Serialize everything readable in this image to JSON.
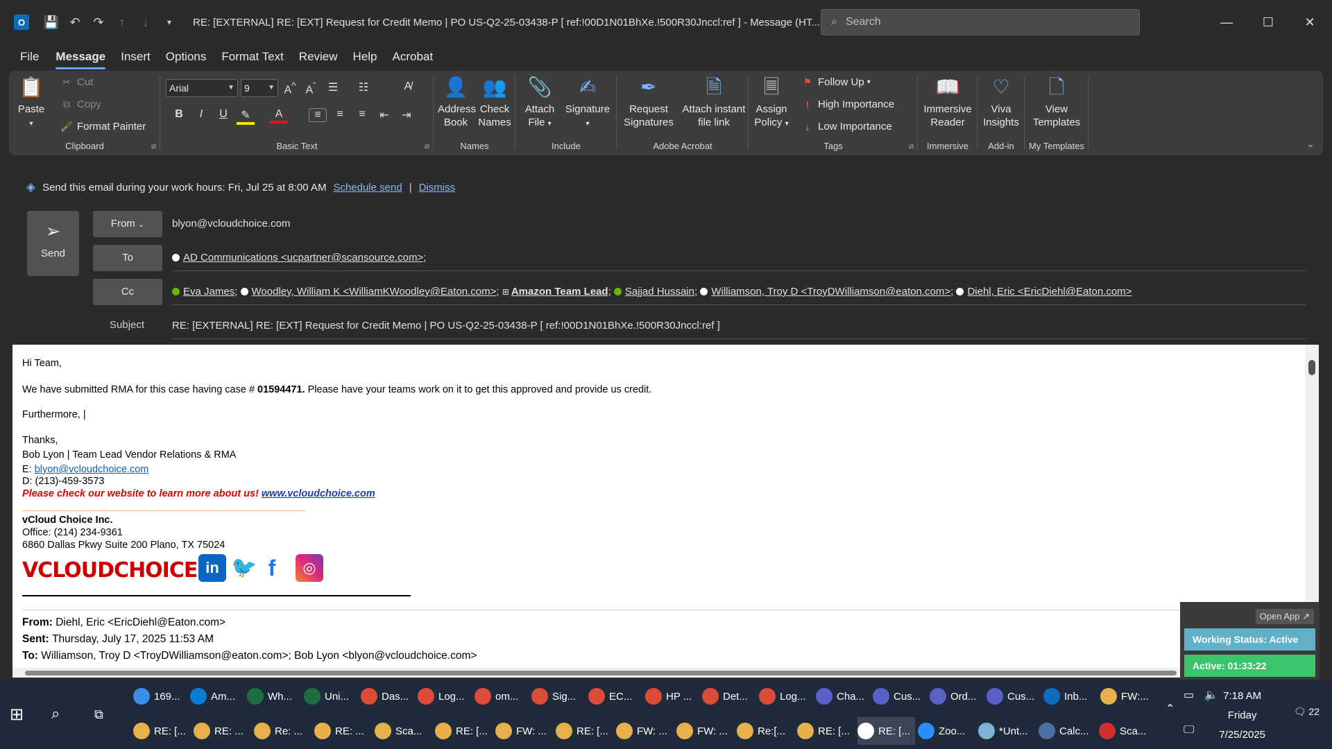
{
  "titlebar": {
    "title": "RE: [EXTERNAL] RE: [EXT] Request for Credit Memo | PO US-Q2-25-03438-P    [ ref:!00D1N01BhXe.!500R30Jnccl:ref ]  -  Message (HT...",
    "search_placeholder": "Search"
  },
  "menu": [
    "File",
    "Message",
    "Insert",
    "Options",
    "Format Text",
    "Review",
    "Help",
    "Acrobat"
  ],
  "ribbon": {
    "clipboard": {
      "label": "Clipboard",
      "paste": "Paste",
      "cut": "Cut",
      "copy": "Copy",
      "format_painter": "Format Painter"
    },
    "basic_text": {
      "label": "Basic Text",
      "font": "Arial",
      "size": "9"
    },
    "names": {
      "label": "Names",
      "address_book_1": "Address",
      "address_book_2": "Book",
      "check_names_1": "Check",
      "check_names_2": "Names"
    },
    "include": {
      "label": "Include",
      "attach_1": "Attach",
      "attach_2": "File",
      "signature": "Signature"
    },
    "adobe": {
      "label": "Adobe Acrobat",
      "req_1": "Request",
      "req_2": "Signatures",
      "attach_link_1": "Attach instant",
      "attach_link_2": "file link"
    },
    "tags": {
      "label": "Tags",
      "assign_1": "Assign",
      "assign_2": "Policy",
      "follow_up": "Follow Up",
      "high": "High Importance",
      "low": "Low Importance"
    },
    "immersive": {
      "label": "Immersive",
      "btn_1": "Immersive",
      "btn_2": "Reader"
    },
    "addin": {
      "label": "Add-in",
      "btn_1": "Viva",
      "btn_2": "Insights"
    },
    "templates": {
      "label": "My Templates",
      "btn_1": "View",
      "btn_2": "Templates"
    }
  },
  "banner": {
    "text": "Send this email during your work hours: Fri, Jul 25 at 8:00 AM",
    "schedule": "Schedule send",
    "pipe": "|",
    "dismiss": "Dismiss"
  },
  "header": {
    "send": "Send",
    "from_label": "From",
    "from_value": "blyon@vcloudchoice.com",
    "to_label": "To",
    "to_recipient": "AD Communications <ucpartner@scansource.com>",
    "cc_label": "Cc",
    "cc": {
      "eva": "Eva James",
      "woodley": "Woodley, William K <WilliamKWoodley@Eaton.com>",
      "amazon": "Amazon Team Lead",
      "sajjad": "Sajjad Hussain",
      "williamson": "Williamson, Troy D <TroyDWilliamson@eaton.com>",
      "diehl": "Diehl, Eric <EricDiehl@Eaton.com>",
      "sep": ";"
    },
    "subject_label": "Subject",
    "subject_value": "RE: [EXTERNAL] RE: [EXT] Request for Credit Memo | PO US-Q2-25-03438-P    [ ref:!00D1N01BhXe.!500R30Jnccl:ref ]"
  },
  "body": {
    "greeting": "Hi Team,",
    "line1_pre": "We have submitted RMA for this case having case # ",
    "line1_case": "01594471.",
    "line1_post": " Please have your teams work on it to get this approved and provide us credit.",
    "furthermore": "Furthermore, |",
    "thanks": "Thanks,",
    "sig_name": "Bob Lyon | Team Lead Vendor Relations & RMA",
    "email_label": "E: ",
    "email": "blyon@vcloudchoice.com",
    "phone": "D: (213)-459-3573",
    "promo_text": "Please check our website to learn more about us! ",
    "promo_link": "www.vcloudchoice.com",
    "company": "vCloud Choice Inc.",
    "office": "Office: (214) 234-9361",
    "address": "6860 Dallas Pkwy Suite 200 Plano, TX 75024",
    "logo": "VCLOUDCHOICE",
    "from_label": "From: ",
    "from_value": "Diehl, Eric <EricDiehl@Eaton.com>",
    "sent_label": "Sent: ",
    "sent_value": "Thursday, July 17, 2025 11:53 AM",
    "to_label": "To: ",
    "to_value": "Williamson, Troy D <TroyDWilliamson@eaton.com>; Bob Lyon <blyon@vcloudchoice.com>"
  },
  "widget": {
    "open_app": "Open App ↗",
    "status": "Working Status: Active",
    "active": "Active: 01:33:22"
  },
  "taskbar": {
    "row1": [
      {
        "label": "169...",
        "color": "#3a8ee6"
      },
      {
        "label": "Am...",
        "color": "#0b7bd6"
      },
      {
        "label": "Wh...",
        "color": "#1d6f42"
      },
      {
        "label": "Uni...",
        "color": "#1d6f42"
      },
      {
        "label": "Das...",
        "color": "#dd4b39"
      },
      {
        "label": "Log...",
        "color": "#dd4b39"
      },
      {
        "label": "om...",
        "color": "#dd4b39"
      },
      {
        "label": "Sig...",
        "color": "#dd4b39"
      },
      {
        "label": "EC...",
        "color": "#dd4b39"
      },
      {
        "label": "HP ...",
        "color": "#dd4b39"
      },
      {
        "label": "Det...",
        "color": "#dd4b39"
      },
      {
        "label": "Log...",
        "color": "#dd4b39"
      },
      {
        "label": "Cha...",
        "color": "#5b5fc7"
      },
      {
        "label": "Cus...",
        "color": "#5b5fc7"
      },
      {
        "label": "Ord...",
        "color": "#5b5fc7"
      },
      {
        "label": "Cus...",
        "color": "#5b5fc7"
      },
      {
        "label": "Inb...",
        "color": "#0f6cbd"
      },
      {
        "label": "FW:...",
        "color": "#e8b04a"
      }
    ],
    "row2": [
      {
        "label": "RE: [...",
        "color": "#e8b04a"
      },
      {
        "label": "RE: ...",
        "color": "#e8b04a"
      },
      {
        "label": "Re: ...",
        "color": "#e8b04a"
      },
      {
        "label": "RE: ...",
        "color": "#e8b04a"
      },
      {
        "label": "Sca...",
        "color": "#e8b04a"
      },
      {
        "label": "RE: [...",
        "color": "#e8b04a"
      },
      {
        "label": "FW: ...",
        "color": "#e8b04a"
      },
      {
        "label": "RE: [...",
        "color": "#e8b04a"
      },
      {
        "label": "FW: ...",
        "color": "#e8b04a"
      },
      {
        "label": "FW: ...",
        "color": "#e8b04a"
      },
      {
        "label": "Re:[...",
        "color": "#e8b04a"
      },
      {
        "label": "RE: [...",
        "color": "#e8b04a"
      },
      {
        "label": "RE: [...",
        "color": "#ffffff"
      },
      {
        "label": "Zoo...",
        "color": "#2d8cff"
      },
      {
        "label": "*Unt...",
        "color": "#7fb3d5"
      },
      {
        "label": "Calc...",
        "color": "#4a6fa5"
      },
      {
        "label": "Sca...",
        "color": "#d32f2f"
      }
    ],
    "time": "7:18 AM",
    "day": "Friday",
    "date": "7/25/2025",
    "notif_count": "22"
  }
}
